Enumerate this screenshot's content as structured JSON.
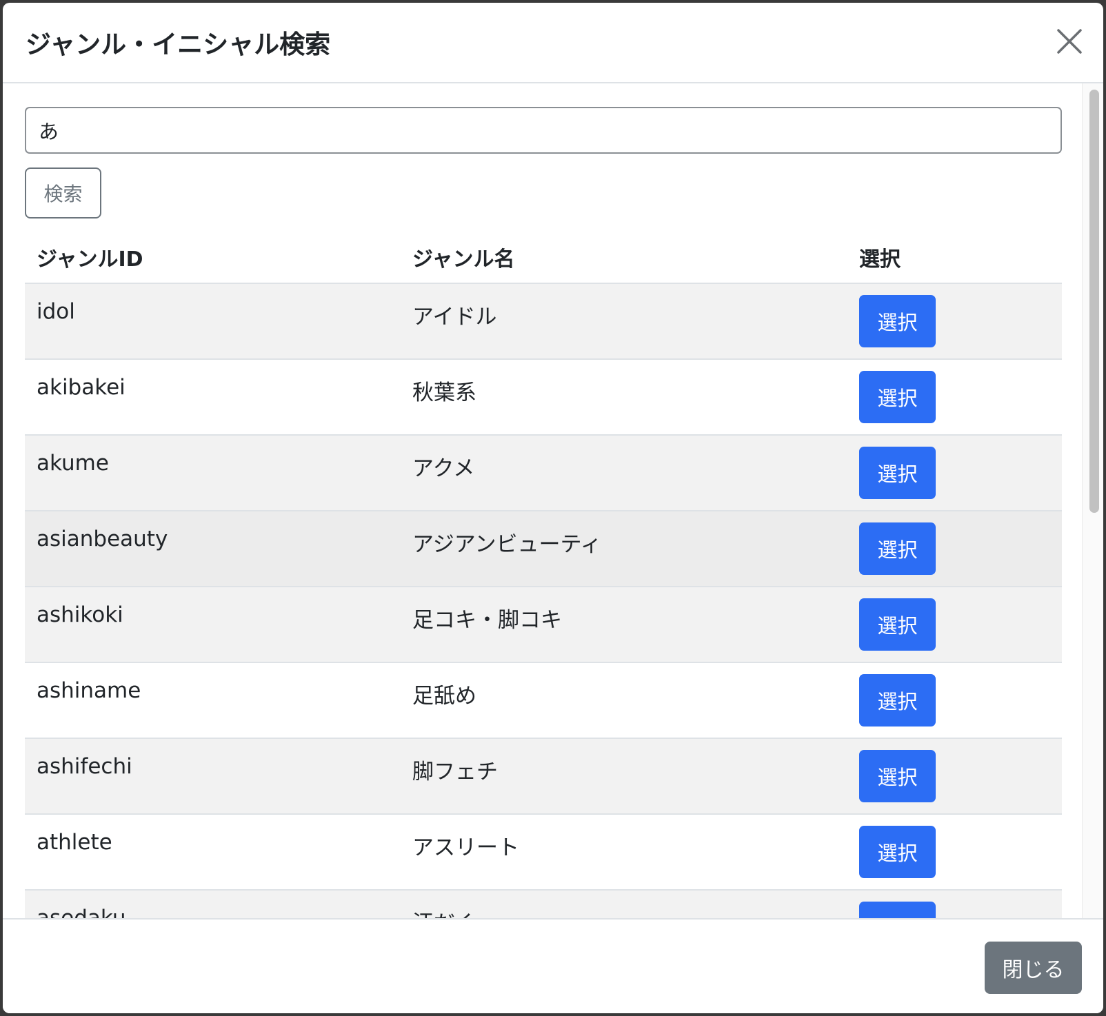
{
  "modal": {
    "title": "ジャンル・イニシャル検索",
    "close_icon": "close-icon"
  },
  "search": {
    "value": "あ",
    "button_label": "検索"
  },
  "table": {
    "headers": [
      "ジャンルID",
      "ジャンル名",
      "選択"
    ],
    "rows": [
      {
        "id": "idol",
        "name": "アイドル",
        "action": "選択"
      },
      {
        "id": "akibakei",
        "name": "秋葉系",
        "action": "選択"
      },
      {
        "id": "akume",
        "name": "アクメ",
        "action": "選択"
      },
      {
        "id": "asianbeauty",
        "name": "アジアンビューティ",
        "action": "選択"
      },
      {
        "id": "ashikoki",
        "name": "足コキ・脚コキ",
        "action": "選択"
      },
      {
        "id": "ashiname",
        "name": "足舐め",
        "action": "選択"
      },
      {
        "id": "ashifechi",
        "name": "脚フェチ",
        "action": "選択"
      },
      {
        "id": "athlete",
        "name": "アスリート",
        "action": "選択"
      },
      {
        "id": "asedaku",
        "name": "汗だく",
        "action": "選択"
      }
    ]
  },
  "footer": {
    "close_label": "閉じる"
  },
  "colors": {
    "primary": "#2c6df4",
    "secondary": "#6c757d",
    "stripe": "#f2f2f2"
  }
}
